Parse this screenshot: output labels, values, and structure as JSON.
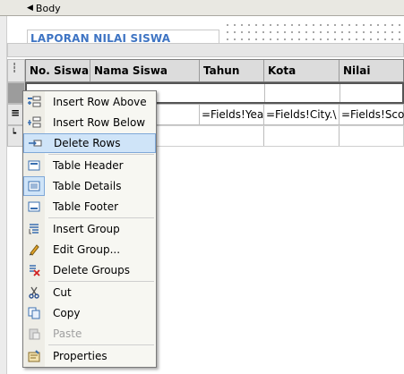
{
  "band": {
    "label": "Body"
  },
  "report": {
    "title": "LAPORAN NILAI SISWA"
  },
  "table": {
    "headers": [
      "No. Siswa",
      "Nama Siswa",
      "Tahun",
      "Kota",
      "Nilai"
    ],
    "data_cells": [
      "",
      "dentNam",
      "=Fields!Yea",
      "=Fields!City.\\",
      "=Fields!Sco"
    ]
  },
  "menu": {
    "items": [
      {
        "label": "Insert Row Above",
        "icon": "insert-row-above-icon"
      },
      {
        "label": "Insert Row Below",
        "icon": "insert-row-below-icon"
      },
      {
        "label": "Delete Rows",
        "icon": "delete-rows-icon",
        "selected": true
      },
      {
        "label": "Table Header",
        "icon": "table-header-icon"
      },
      {
        "label": "Table Details",
        "icon": "table-details-icon"
      },
      {
        "label": "Table Footer",
        "icon": "table-footer-icon"
      },
      {
        "label": "Insert Group",
        "icon": "insert-group-icon"
      },
      {
        "label": "Edit Group...",
        "icon": "edit-group-icon"
      },
      {
        "label": "Delete Groups",
        "icon": "delete-groups-icon"
      },
      {
        "label": "Cut",
        "icon": "cut-icon"
      },
      {
        "label": "Copy",
        "icon": "copy-icon"
      },
      {
        "label": "Paste",
        "icon": "paste-icon",
        "disabled": true
      },
      {
        "label": "Properties",
        "icon": "properties-icon"
      }
    ]
  },
  "colors": {
    "title": "#3e74c3",
    "selection": "#cfe4f8"
  }
}
